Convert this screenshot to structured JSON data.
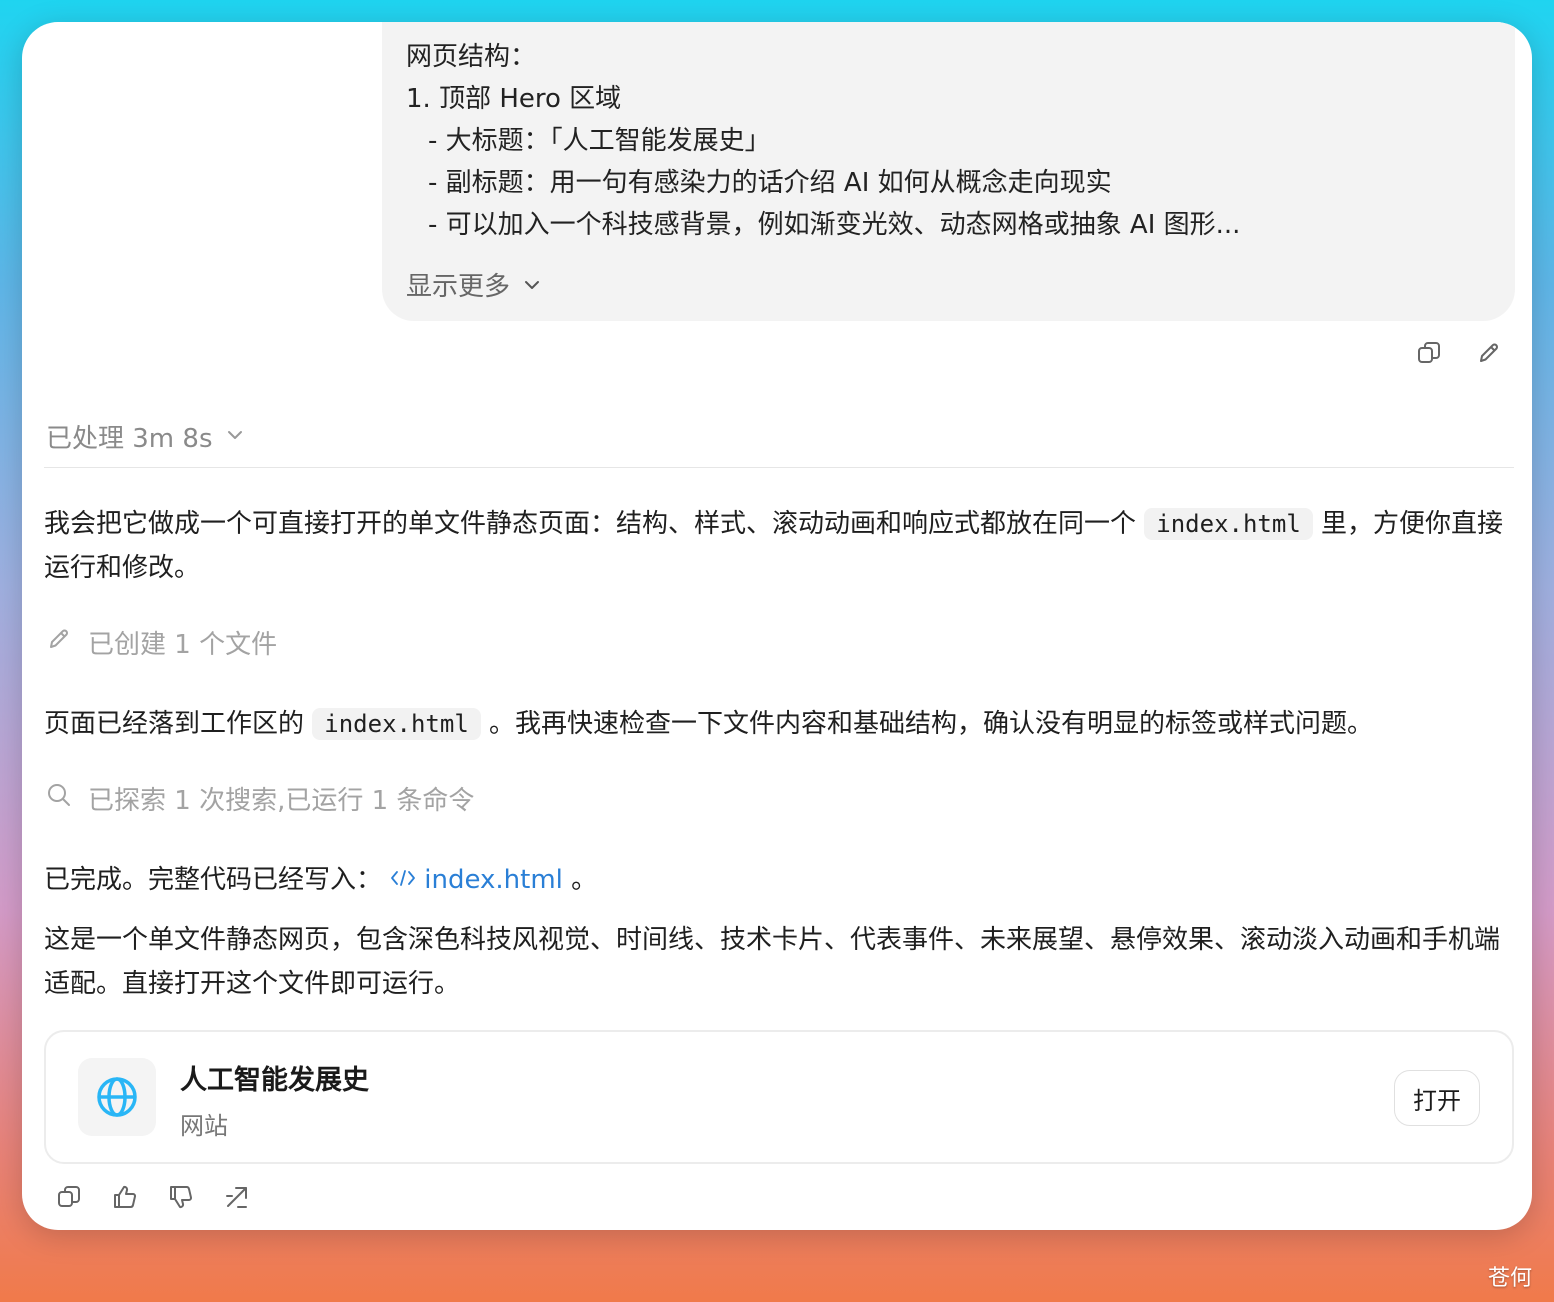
{
  "user_message": {
    "lines": [
      "网页结构：",
      "1. 顶部 Hero 区域",
      "- 大标题：「人工智能发展史」",
      "- 副标题：用一句有感染力的话介绍 AI 如何从概念走向现实",
      "- 可以加入一个科技感背景，例如渐变光效、动态网格或抽象 AI 图形..."
    ],
    "show_more": "显示更多"
  },
  "processed_label": "已处理 3m 8s",
  "paragraph1": {
    "before": "我会把它做成一个可直接打开的单文件静态页面：结构、样式、滚动动画和响应式都放在同一个",
    "code": "index.html",
    "after": "里，方便你直接运行和修改。"
  },
  "step_created": "已创建 1 个文件",
  "paragraph2": {
    "before": "页面已经落到工作区的",
    "code": "index.html",
    "after": "。我再快速检查一下文件内容和基础结构，确认没有明显的标签或样式问题。"
  },
  "step_explored": "已探索 1 次搜索,已运行 1 条命令",
  "paragraph3": {
    "before": "已完成。完整代码已经写入：",
    "link": "index.html",
    "after": "。"
  },
  "paragraph4": "这是一个单文件静态网页，包含深色科技风视觉、时间线、技术卡片、代表事件、未来展望、悬停效果、滚动淡入动画和手机端适配。直接打开这个文件即可运行。",
  "card": {
    "title": "人工智能发展史",
    "subtitle": "网站",
    "open_label": "打开",
    "icon": "globe-icon",
    "icon_color": "#29b6f6"
  },
  "watermark": "苍何",
  "colors": {
    "link": "#2a7fd6",
    "muted": "#a3a3a3"
  }
}
